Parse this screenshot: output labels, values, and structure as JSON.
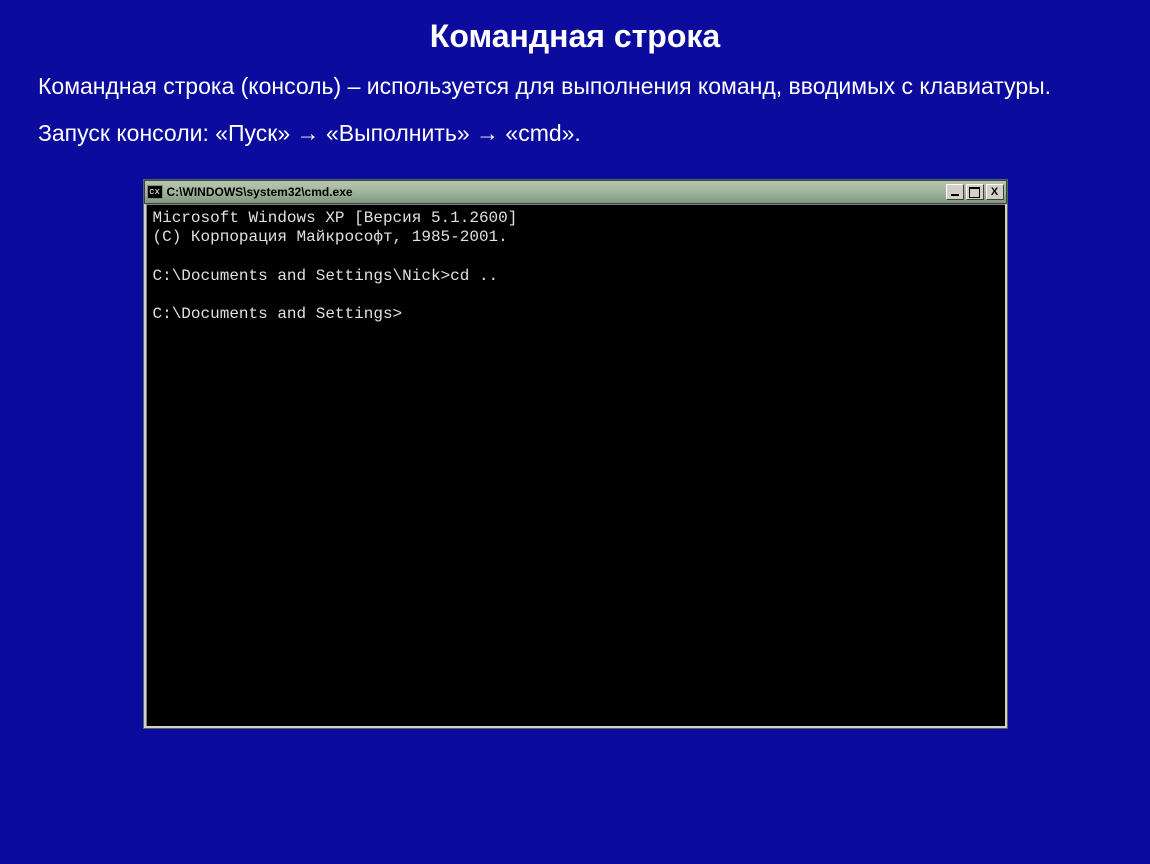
{
  "slide": {
    "title": "Командная строка",
    "paragraph1": "Командная строка (консоль) – используется для выполнения команд, вводимых с клавиатуры.",
    "paragraph2": "Запуск консоли: «Пуск» → «Выполнить» → «cmd»."
  },
  "window": {
    "icon_label": "cx",
    "title": "C:\\WINDOWS\\system32\\cmd.exe",
    "buttons": {
      "minimize": "_",
      "maximize": "□",
      "close": "X"
    }
  },
  "console": {
    "line1": "Microsoft Windows XP [Версия 5.1.2600]",
    "line2": "(С) Корпорация Майкрософт, 1985-2001.",
    "blank1": " ",
    "line3": "C:\\Documents and Settings\\Nick>cd ..",
    "blank2": " ",
    "line4": "C:\\Documents and Settings>"
  }
}
